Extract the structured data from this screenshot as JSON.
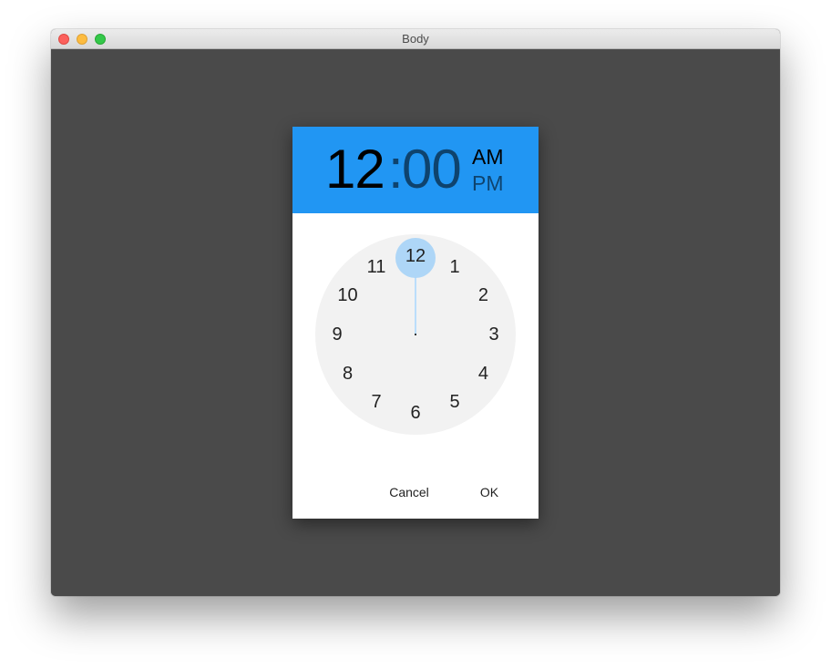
{
  "window": {
    "title": "Body"
  },
  "time_picker": {
    "hour": "12",
    "separator": ":",
    "minute": "00",
    "am_label": "AM",
    "pm_label": "PM",
    "selected_period": "AM",
    "selected_number": "12",
    "clock_numbers": [
      "12",
      "1",
      "2",
      "3",
      "4",
      "5",
      "6",
      "7",
      "8",
      "9",
      "10",
      "11"
    ],
    "cancel_label": "Cancel",
    "ok_label": "OK"
  },
  "colors": {
    "header": "#2196f3",
    "selection": "#aed6f7",
    "window_background": "#4a4a4a",
    "clock_face": "#f2f2f2"
  }
}
